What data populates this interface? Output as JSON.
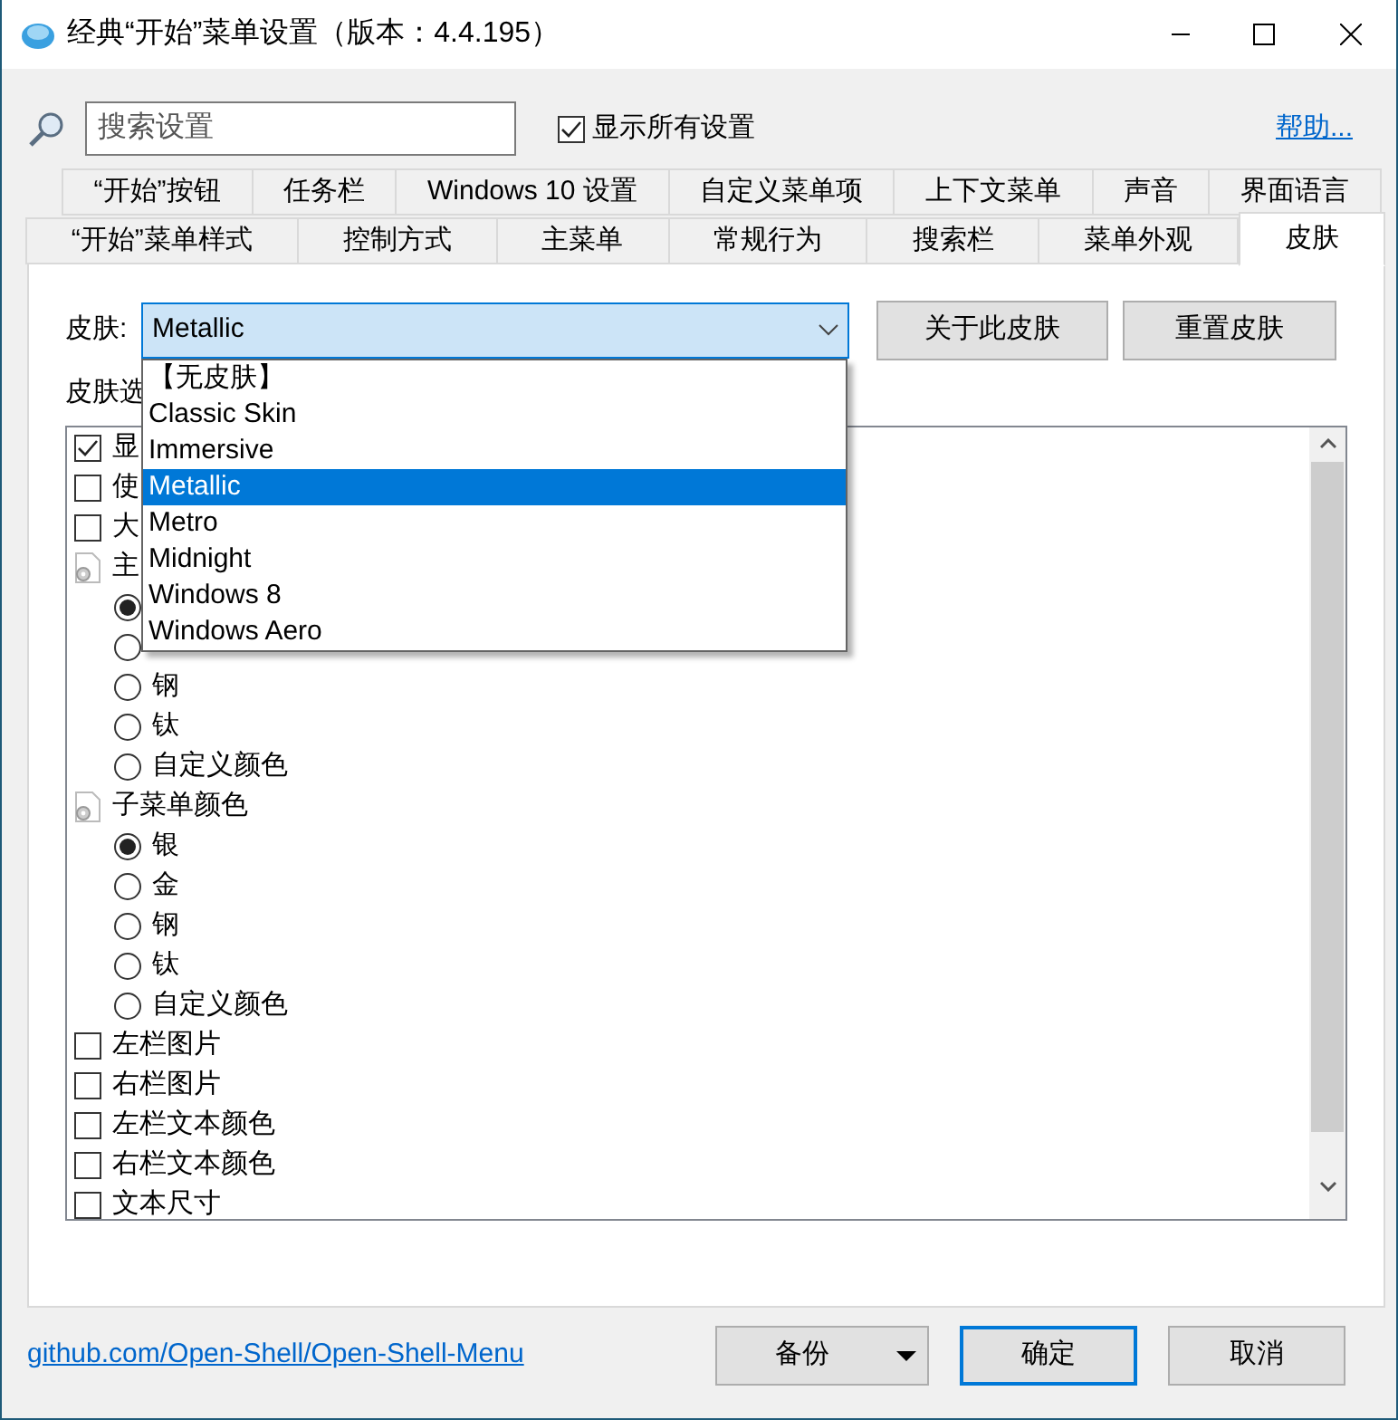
{
  "window": {
    "title": "经典“开始”菜单设置（版本：4.4.195）"
  },
  "search": {
    "placeholder": "搜索设置"
  },
  "show_all": {
    "label": "显示所有设置",
    "checked": true
  },
  "help_link": "帮助...",
  "tab_rows": [
    [
      {
        "label": "“开始”按钮",
        "selected": false
      },
      {
        "label": "任务栏",
        "selected": false
      },
      {
        "label": "Windows 10 设置",
        "selected": false
      },
      {
        "label": "自定义菜单项",
        "selected": false
      },
      {
        "label": "上下文菜单",
        "selected": false
      },
      {
        "label": "声音",
        "selected": false
      },
      {
        "label": "界面语言",
        "selected": false
      }
    ],
    [
      {
        "label": "“开始”菜单样式",
        "selected": false
      },
      {
        "label": "控制方式",
        "selected": false
      },
      {
        "label": "主菜单",
        "selected": false
      },
      {
        "label": "常规行为",
        "selected": false
      },
      {
        "label": "搜索栏",
        "selected": false
      },
      {
        "label": "菜单外观",
        "selected": false
      },
      {
        "label": "皮肤",
        "selected": true
      }
    ]
  ],
  "skin": {
    "label": "皮肤:",
    "value": "Metallic",
    "expanded": true,
    "options": [
      {
        "label": "【无皮肤】",
        "selected": false
      },
      {
        "label": "Classic Skin",
        "selected": false
      },
      {
        "label": "Immersive",
        "selected": false
      },
      {
        "label": "Metallic",
        "selected": true
      },
      {
        "label": "Metro",
        "selected": false
      },
      {
        "label": "Midnight",
        "selected": false
      },
      {
        "label": "Windows 8",
        "selected": false
      },
      {
        "label": "Windows Aero",
        "selected": false
      }
    ]
  },
  "skin_buttons": [
    "关于此皮肤",
    "重置皮肤"
  ],
  "options_label": "皮肤选",
  "options": [
    {
      "kind": "checkbox",
      "label": "显",
      "checked": true
    },
    {
      "kind": "checkbox",
      "label": "使",
      "checked": false
    },
    {
      "kind": "checkbox",
      "label": "大",
      "checked": false
    },
    {
      "kind": "group",
      "label": "主",
      "children": [
        {
          "kind": "radio",
          "checked": true
        },
        {
          "kind": "radio",
          "checked": false
        },
        {
          "kind": "radio",
          "label": "钢",
          "checked": false
        },
        {
          "kind": "radio",
          "label": "钛",
          "checked": false
        },
        {
          "kind": "radio",
          "label": "自定义颜色",
          "checked": false
        }
      ]
    },
    {
      "kind": "group",
      "label": "子菜单颜色",
      "children": [
        {
          "kind": "radio",
          "label": "银",
          "checked": true
        },
        {
          "kind": "radio",
          "label": "金",
          "checked": false
        },
        {
          "kind": "radio",
          "label": "钢",
          "checked": false
        },
        {
          "kind": "radio",
          "label": "钛",
          "checked": false
        },
        {
          "kind": "radio",
          "label": "自定义颜色",
          "checked": false
        }
      ]
    },
    {
      "kind": "checkbox",
      "label": "左栏图片",
      "checked": false
    },
    {
      "kind": "checkbox",
      "label": "右栏图片",
      "checked": false
    },
    {
      "kind": "checkbox",
      "label": "左栏文本颜色",
      "checked": false
    },
    {
      "kind": "checkbox",
      "label": "右栏文本颜色",
      "checked": false
    },
    {
      "kind": "checkbox",
      "label": "文本尺寸",
      "checked": false
    }
  ],
  "footer": {
    "link": "github.com/Open-Shell/Open-Shell-Menu",
    "buttons": [
      {
        "label": "备份",
        "kind": "split"
      },
      {
        "label": "确定",
        "kind": "default"
      },
      {
        "label": "取消",
        "kind": "plain"
      }
    ]
  }
}
